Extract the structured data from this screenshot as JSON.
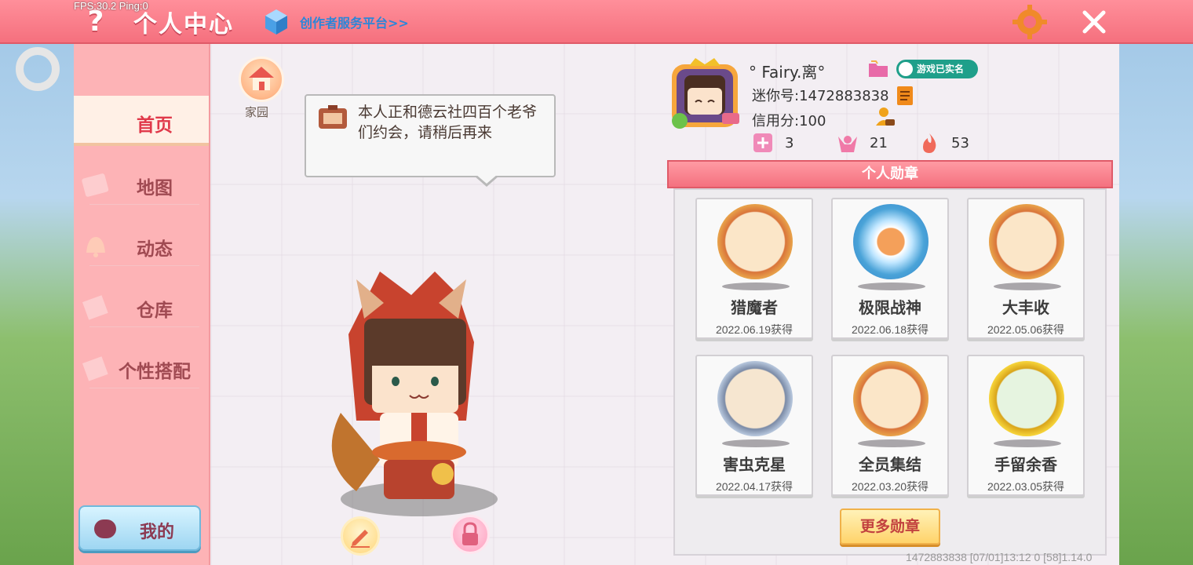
{
  "overlay": {
    "fps_text": "FPS:30.2  Ping:0"
  },
  "header": {
    "title": "个人中心",
    "creator_link": "创作者服务平台>>",
    "help_icon": "help-icon",
    "settings_icon": "gear-icon",
    "close_icon": "close-icon"
  },
  "sidebar": {
    "items": [
      {
        "label": "首页",
        "active": true
      },
      {
        "label": "地图",
        "active": false
      },
      {
        "label": "动态",
        "active": false
      },
      {
        "label": "仓库",
        "active": false
      },
      {
        "label": "个性搭配",
        "active": false
      }
    ],
    "mine_label": "我的"
  },
  "home": {
    "label": "家园"
  },
  "bubble": {
    "text": "本人正和德云社四百个老爷们约会，请稍后再来"
  },
  "profile": {
    "nickname": "° Fairy.离°",
    "realname_badge": "游戏已实名",
    "mini_id": "迷你号:1472883838",
    "credit": "信用分:100",
    "stats": [
      {
        "icon": "plus-star-icon",
        "value": "3"
      },
      {
        "icon": "cheer-icon",
        "value": "21"
      },
      {
        "icon": "flame-icon",
        "value": "53"
      }
    ]
  },
  "medals": {
    "title": "个人勋章",
    "items": [
      {
        "name": "猎魔者",
        "date": "2022.06.19获得",
        "color": "#e8a24a"
      },
      {
        "name": "极限战神",
        "date": "2022.06.18获得",
        "color": "#4aa3d8"
      },
      {
        "name": "大丰收",
        "date": "2022.05.06获得",
        "color": "#e8a24a"
      },
      {
        "name": "害虫克星",
        "date": "2022.04.17获得",
        "color": "#8fa6c2"
      },
      {
        "name": "全员集结",
        "date": "2022.03.20获得",
        "color": "#e8a24a"
      },
      {
        "name": "手留余香",
        "date": "2022.03.05获得",
        "color": "#e7c02e"
      }
    ],
    "more_label": "更多勋章"
  },
  "footer": {
    "text": "1472883838     [07/01]13:12 0    [58]1.14.0"
  }
}
